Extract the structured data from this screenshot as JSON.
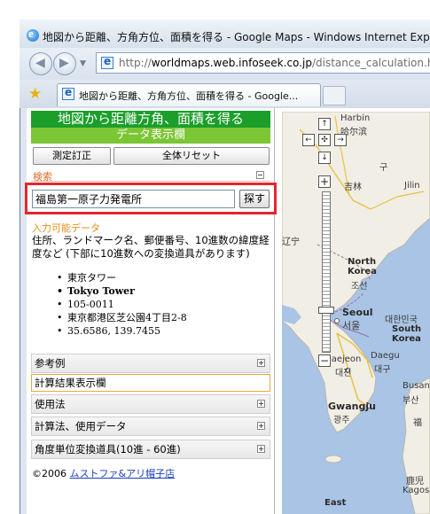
{
  "window": {
    "title": "地図から距離、方角方位、面積を得る - Google Maps - Windows Internet Expl",
    "address": "http://worldmaps.web.infoseek.co.jp/distance_calculation.ht",
    "address_host": "worldmaps.web.infoseek.co.jp",
    "address_prefix": "http://",
    "address_suffix": "/distance_calculation.ht",
    "tab_title": "地図から距離、方角方位、面積を得る - Google..."
  },
  "sidebar": {
    "header_title": "地図から距離方角、面積を得る",
    "header_subtitle": "データ表示欄",
    "measure_button": "測定訂正",
    "reset_button": "全体リセット",
    "search_label": "検索",
    "search_value": "福島第一原子力発電所",
    "search_button": "探す",
    "input_title": "入力可能データ",
    "input_description": "住所、ランドマーク名、郵便番号、10進数の緯度経度など (下部に10進数への変換道具があります)",
    "examples": [
      "東京タワー",
      "Tokyo Tower",
      "105-0011",
      "東京都港区芝公園4丁目2-8",
      "35.6586, 139.7455"
    ],
    "sections": [
      "参考例",
      "使用法",
      "計算法、使用データ",
      "角度単位変換道具(10進 - 60進)"
    ],
    "result_section": "計算結果表示欄",
    "copyright_prefix": "©2006",
    "copyright_link": "ムストファ&アリ帽子店"
  },
  "map": {
    "labels": {
      "harbin": "Harbin",
      "harbin_kanji": "哈尔滨",
      "jilin": "吉林",
      "jilin_roman": "Jilin",
      "korea_fragment": "구",
      "reg_fragment": "辽宁",
      "north_korea": "North\nKorea",
      "north_korea_k": "조선",
      "seoul": "Seoul",
      "seoul_k": "서울",
      "south_korea": "South\nKorea",
      "south_korea_k": "대한민국",
      "daejeon": "Daejeon",
      "daejeon_k": "대전",
      "daegu": "Daegu",
      "daegu_k": "대구",
      "busan": "Busan",
      "busan_k": "부산",
      "gwangju": "Gwangju",
      "gwangju_k": "광주",
      "kagoshima": "Kagos",
      "kagoshima_k": "鹿児",
      "fukuoka": "福",
      "east": "East",
      "pan_north": "↑",
      "pan_south": "↓",
      "pan_west": "←",
      "pan_east": "→",
      "pan_center": "✣",
      "zoom_in": "+",
      "zoom_out": "−"
    }
  },
  "colors": {
    "header_dark_green": "#1b9e2a",
    "header_light_green": "#7bc634",
    "highlight_red": "#e3262f",
    "accent_orange": "#e69018",
    "sea": "#a9c4e4",
    "land": "#f1eee6"
  }
}
